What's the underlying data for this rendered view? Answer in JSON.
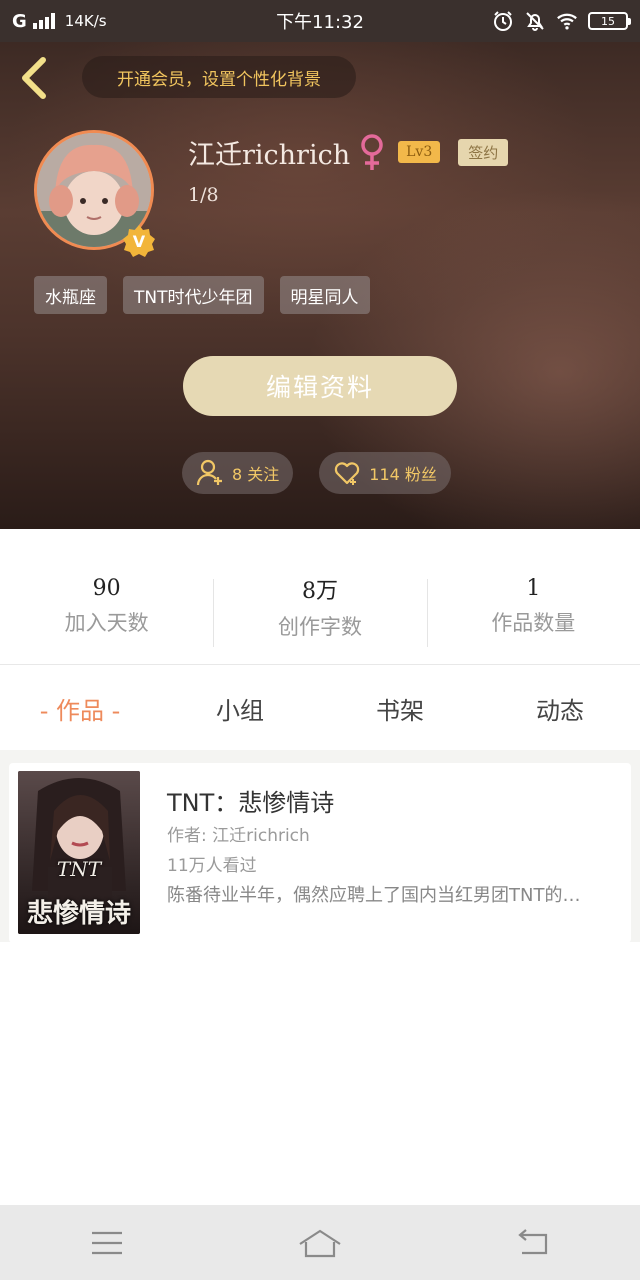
{
  "status_bar": {
    "network": "G",
    "speed": "14K/s",
    "time": "下午11:32",
    "battery": "15"
  },
  "header": {
    "vip_banner": "开通会员，设置个性化背景",
    "username": "江迁richrich",
    "level": "Lv3",
    "signed": "签约",
    "progress": "1/8",
    "avatar_badge": "V",
    "tags": [
      "水瓶座",
      "TNT时代少年团",
      "明星同人"
    ],
    "edit_button": "编辑资料",
    "following": "8 关注",
    "followers": "114 粉丝"
  },
  "stats": [
    {
      "value": "90",
      "label": "加入天数"
    },
    {
      "value": "8万",
      "label": "创作字数"
    },
    {
      "value": "1",
      "label": "作品数量"
    }
  ],
  "tabs": [
    {
      "label": "- 作品 -",
      "active": true
    },
    {
      "label": "小组",
      "active": false
    },
    {
      "label": "书架",
      "active": false
    },
    {
      "label": "动态",
      "active": false
    }
  ],
  "works": [
    {
      "title": "TNT：悲惨情诗",
      "author": "作者: 江迁richrich",
      "views": "11万人看过",
      "description": "陈番待业半年，偶然应聘上了国内当红男团TNT的…",
      "cover_title": "悲惨情诗",
      "cover_tnt": "TNT"
    }
  ],
  "colors": {
    "accent_orange": "#ee8a5b",
    "gold": "#f1c766",
    "edit_button_bg": "#e6d9b4"
  }
}
